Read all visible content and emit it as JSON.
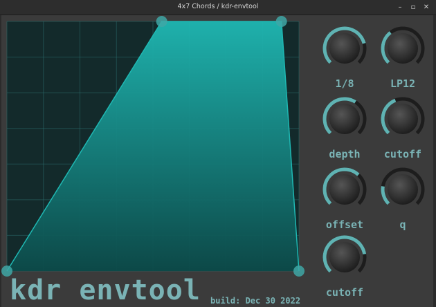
{
  "window": {
    "title": "4x7 Chords / kdr-envtool",
    "minimize_glyph": "–",
    "maximize_glyph": "▫",
    "close_glyph": "✕"
  },
  "colors": {
    "panel": "#3b3b3b",
    "envelope_bg": "#132a2b",
    "grid": "#2c6b6c",
    "envelope_fill_top": "#1fb8b3",
    "envelope_fill_bottom": "#0c4a49",
    "node": "#3fa7a6",
    "accent_text": "#7ab3b5",
    "knob_track": "#1d1d1d",
    "knob_value": "#5fb3b3"
  },
  "plugin": {
    "brand": "kdr envtool",
    "build": "build: Dec 30 2022"
  },
  "envelope": {
    "points": [
      {
        "t": 0.0,
        "level": 0.0
      },
      {
        "t": 0.53,
        "level": 1.0
      },
      {
        "t": 0.94,
        "level": 1.0
      },
      {
        "t": 1.0,
        "level": 0.0
      }
    ],
    "grid_columns": 8,
    "grid_rows": 7
  },
  "knobs": [
    {
      "id": "rate",
      "label": "1/8",
      "value": 0.78
    },
    {
      "id": "filter-type",
      "label": "LP12",
      "value": 0.36
    },
    {
      "id": "depth",
      "label": "depth",
      "value": 0.62
    },
    {
      "id": "cutoff-1",
      "label": "cutoff",
      "value": 0.42
    },
    {
      "id": "offset",
      "label": "offset",
      "value": 0.66
    },
    {
      "id": "q",
      "label": "q",
      "value": 0.2
    },
    {
      "id": "cutoff-2",
      "label": "cutoff",
      "value": 0.8
    }
  ]
}
